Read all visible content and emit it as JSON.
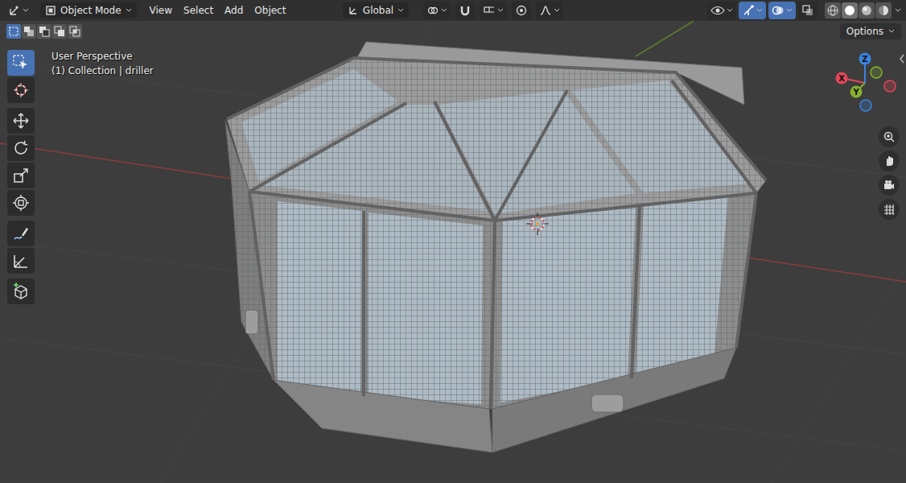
{
  "header": {
    "editor_type": {
      "kind": "view3d"
    },
    "mode": "Object Mode",
    "menus": [
      "View",
      "Select",
      "Add",
      "Object"
    ],
    "orientation": "Global",
    "toggles": [
      {
        "kind": "pivot",
        "on": false
      },
      {
        "kind": "snap",
        "on": false
      },
      {
        "kind": "snap-target",
        "on": false
      },
      {
        "kind": "proportional",
        "on": false
      },
      {
        "kind": "falloff",
        "on": false
      }
    ],
    "visibility": [
      {
        "kind": "view-objects",
        "on": false
      },
      {
        "kind": "gizmos",
        "on": true
      },
      {
        "kind": "overlays",
        "on": true
      },
      {
        "kind": "xray",
        "on": false
      }
    ],
    "shading": [
      {
        "kind": "wireframe",
        "selected": false
      },
      {
        "kind": "solid",
        "selected": true
      },
      {
        "kind": "material",
        "selected": false
      },
      {
        "kind": "rendered",
        "selected": false
      }
    ]
  },
  "select_modes": [
    {
      "kind": "new",
      "selected": true
    },
    {
      "kind": "extend",
      "selected": false
    },
    {
      "kind": "subtract",
      "selected": false
    },
    {
      "kind": "invert",
      "selected": false
    },
    {
      "kind": "intersect",
      "selected": false
    }
  ],
  "options": "Options",
  "viewport": {
    "perspective": "User Perspective",
    "context": "(1) Collection | driller"
  },
  "tool_groups": [
    [
      {
        "kind": "select-box",
        "selected": true
      },
      {
        "kind": "cursor",
        "selected": false
      }
    ],
    [
      {
        "kind": "move",
        "selected": false
      },
      {
        "kind": "rotate",
        "selected": false
      },
      {
        "kind": "scale",
        "selected": false
      },
      {
        "kind": "transform",
        "selected": false
      }
    ],
    [
      {
        "kind": "annotate",
        "selected": false
      },
      {
        "kind": "measure",
        "selected": false
      }
    ],
    [
      {
        "kind": "add-cube",
        "selected": false
      }
    ]
  ],
  "gizmo": {
    "axes": [
      {
        "label": "X",
        "color": "#e3485a"
      },
      {
        "label": "Y",
        "color": "#85b12e"
      },
      {
        "label": "Z",
        "color": "#3a84e0"
      }
    ]
  },
  "navigation": [
    {
      "kind": "zoom"
    },
    {
      "kind": "pan"
    },
    {
      "kind": "camera"
    },
    {
      "kind": "ortho"
    }
  ]
}
